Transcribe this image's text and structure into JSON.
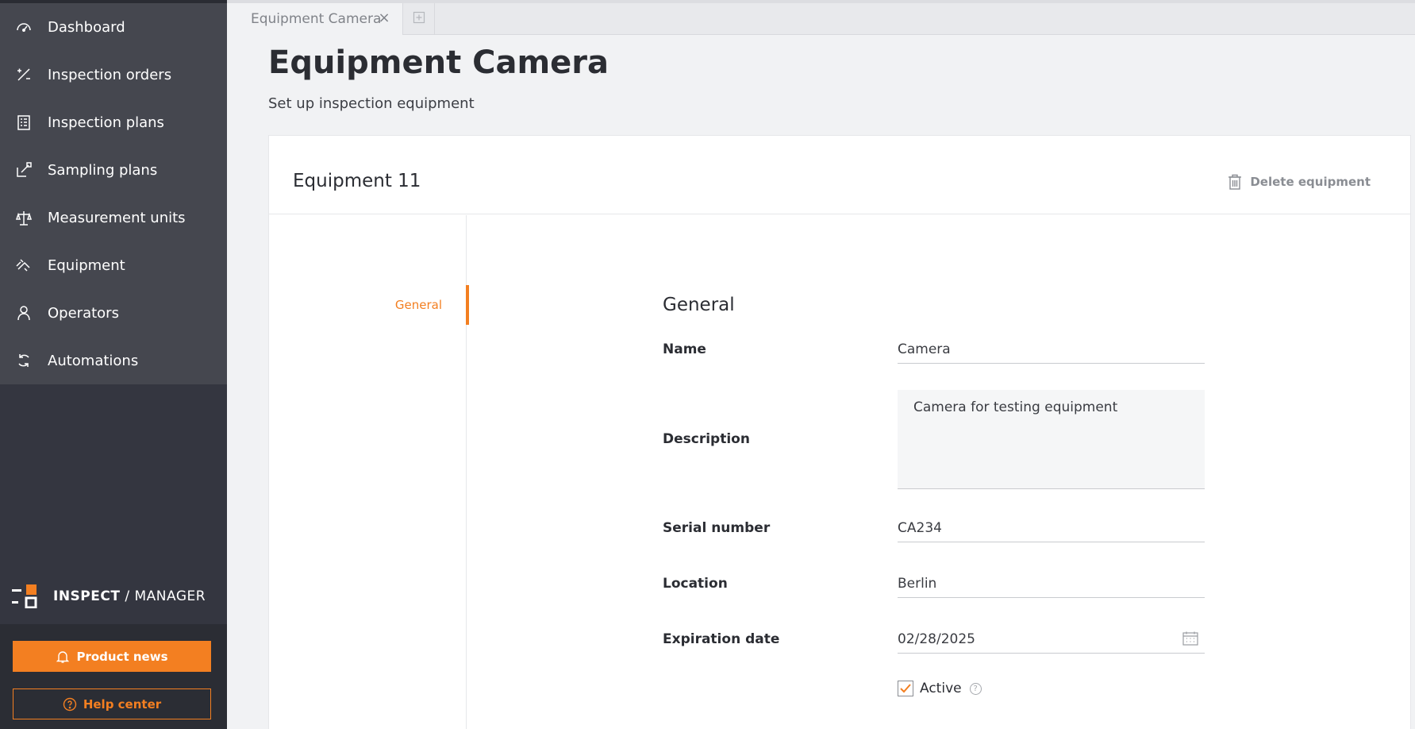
{
  "sidebar": {
    "items": [
      {
        "label": "Dashboard",
        "icon": "gauge-icon"
      },
      {
        "label": "Inspection orders",
        "icon": "percent-icon"
      },
      {
        "label": "Inspection plans",
        "icon": "clipboard-list-icon"
      },
      {
        "label": "Sampling plans",
        "icon": "sampling-icon"
      },
      {
        "label": "Measurement units",
        "icon": "scale-icon"
      },
      {
        "label": "Equipment",
        "icon": "caliper-icon"
      },
      {
        "label": "Operators",
        "icon": "person-icon"
      },
      {
        "label": "Automations",
        "icon": "refresh-icon"
      }
    ],
    "brand_bold": "INSPECT",
    "brand_sep": " / ",
    "brand_rest": "MANAGER",
    "product_news": "Product news",
    "help_center": "Help center"
  },
  "tabs": [
    {
      "label": "Equipment Camera"
    }
  ],
  "page": {
    "title": "Equipment Camera",
    "subtitle": "Set up inspection equipment"
  },
  "card": {
    "title": "Equipment 11",
    "delete_label": "Delete equipment",
    "side_nav": "General",
    "section_title": "General"
  },
  "form": {
    "name_label": "Name",
    "name_value": "Camera",
    "description_label": "Description",
    "description_value": "Camera for testing equipment",
    "serial_label": "Serial number",
    "serial_value": "CA234",
    "location_label": "Location",
    "location_value": "Berlin",
    "expiration_label": "Expiration date",
    "expiration_value": "02/28/2025",
    "active_label": "Active",
    "active_checked": true
  },
  "colors": {
    "accent": "#f37f21",
    "sidebar_dark": "#343640",
    "sidebar_nav": "#45474f"
  }
}
